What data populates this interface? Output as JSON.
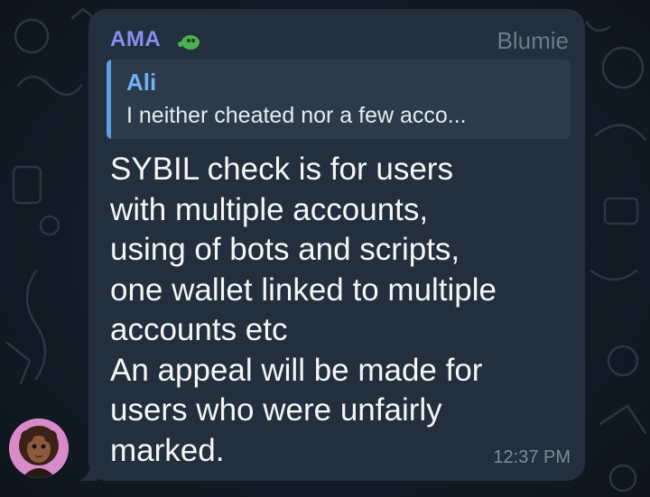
{
  "message": {
    "sender_name": "AMA",
    "sender_badge_icon": "green-blob-emoji",
    "sender_role": "Blumie",
    "reply": {
      "author": "Ali",
      "preview": "I neither cheated nor a few acco..."
    },
    "text": "SYBIL check is for users\nwith multiple accounts,\nusing of bots and scripts,\none wallet linked to multiple\naccounts etc\nAn appeal will be made for\nusers who were unfairly\nmarked.",
    "time": "12:37 PM"
  },
  "colors": {
    "background": "#0e1621",
    "bubble": "#232f3d",
    "sender_name": "#8a8ff0",
    "reply_accent": "#5a9ee8",
    "reply_author": "#6fb2f2",
    "text": "#f4f6f8",
    "meta": "#7f8b98"
  },
  "avatar_icon": "girl-avatar-icon"
}
